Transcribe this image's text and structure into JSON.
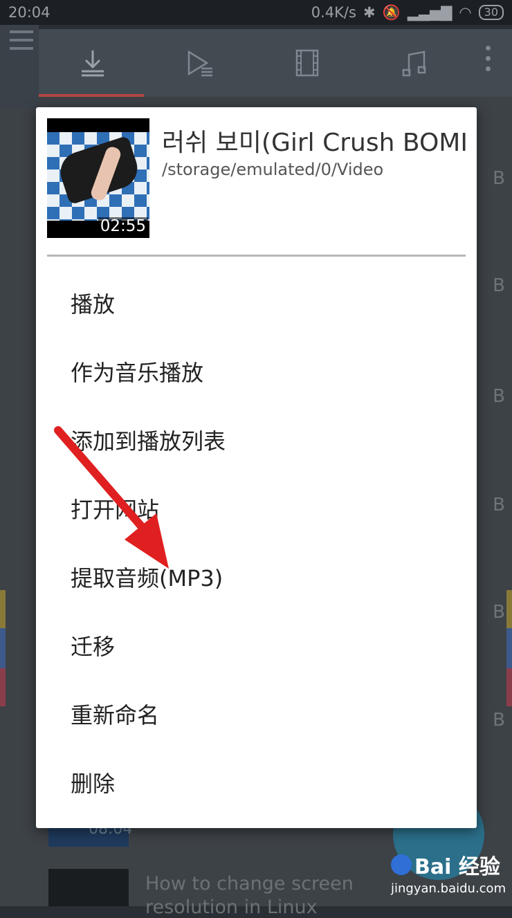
{
  "status_bar": {
    "time": "20:04",
    "network_speed": "0.4K/s",
    "battery": "30"
  },
  "toolbar": {
    "tabs": [
      "download-icon",
      "playlist-icon",
      "film-icon",
      "music-note-icon"
    ],
    "more_icon": "more-vert-icon"
  },
  "dialog": {
    "video_title": "러쉬 보미(Girl Crush BOMI)",
    "video_path": "/storage/emulated/0/Video",
    "duration": "02:55",
    "menu": [
      {
        "label": "播放"
      },
      {
        "label": "作为音乐播放"
      },
      {
        "label": "添加到播放列表"
      },
      {
        "label": "打开网站"
      },
      {
        "label": "提取音频(MP3)"
      },
      {
        "label": "迁移"
      },
      {
        "label": "重新命名"
      },
      {
        "label": "删除"
      }
    ]
  },
  "background": {
    "size_suffix": "B",
    "partial_duration": "08:04",
    "partial_title_line1": "How to change screen",
    "partial_title_line2": "resolution in Linux"
  },
  "watermark": {
    "logo": "Bai  经验",
    "url": "jingyan.baidu.com"
  },
  "colors": {
    "arrow": "#e02020",
    "toolbar_accent": "#b3473f",
    "fab": "#2b6f8a"
  }
}
